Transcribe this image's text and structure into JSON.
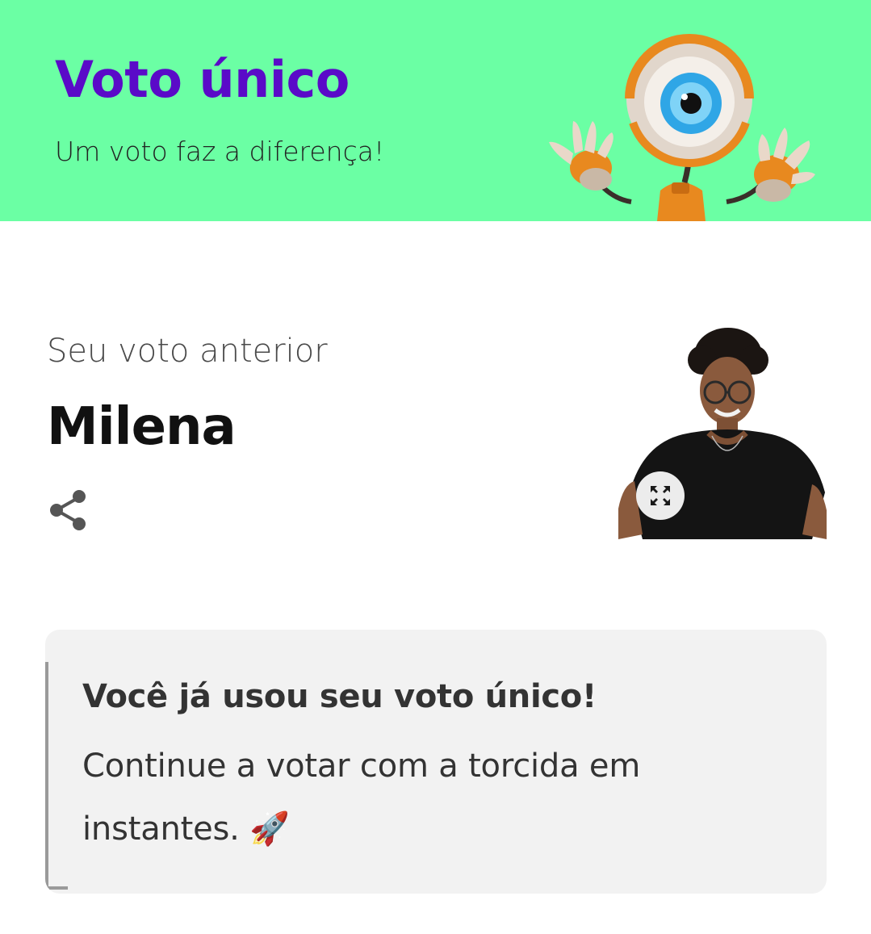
{
  "banner": {
    "title": "Voto único",
    "subtitle": "Um voto faz a diferença!",
    "mascot_icon": "big-brother-eye-mascot",
    "background_color": "#6bffa4",
    "title_color": "#5a0ac8"
  },
  "vote": {
    "label": "Seu voto anterior",
    "candidate": "Milena",
    "share_icon": "share-icon",
    "expand_icon": "expand-icon"
  },
  "notice": {
    "title": "Você já usou seu voto único!",
    "text": "Continue a votar com a torcida em instantes. 🚀"
  }
}
